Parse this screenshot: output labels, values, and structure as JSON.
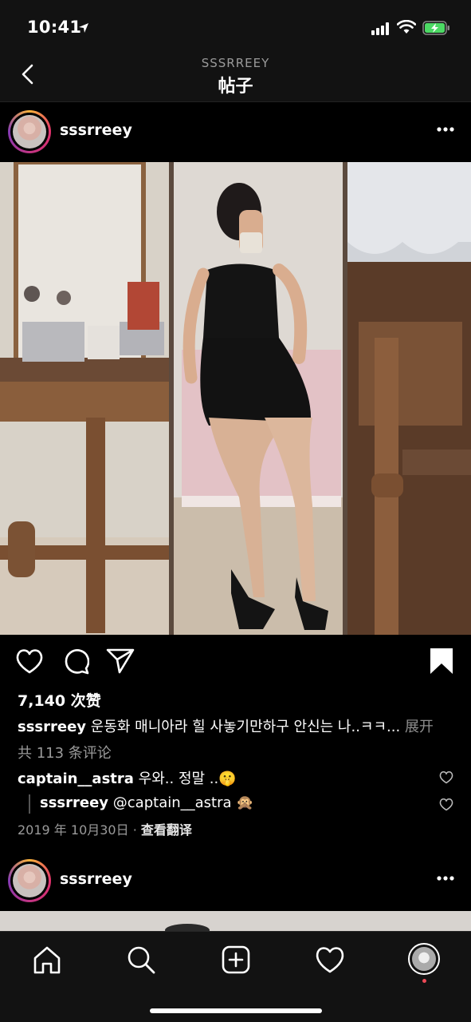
{
  "status_bar": {
    "time": "10:41"
  },
  "nav": {
    "subtitle": "SSSRREEY",
    "title": "帖子"
  },
  "post": {
    "username": "sssrreey",
    "likes": "7,140 次赞",
    "caption_user": "sssrreey",
    "caption_text": "운동화 매니아라 힐 사놓기만하구 안신는 나..ㅋㅋ...",
    "caption_more": "展开",
    "comments_count": "共 113 条评论",
    "comments": [
      {
        "user": "captain__astra",
        "text": "우와.. 정말 ..🤫"
      },
      {
        "user": "sssrreey",
        "text": "@captain__astra 🙊"
      }
    ],
    "date": "2019 年 10月30日 ·",
    "translate": "查看翻译"
  },
  "next_post": {
    "username": "sssrreey"
  },
  "icons": {
    "back": "chevron-left-icon",
    "more": "more-horizontal-icon",
    "like": "heart-icon",
    "comment": "comment-icon",
    "share": "paper-plane-icon",
    "save": "bookmark-icon",
    "tabs": [
      "home-icon",
      "search-icon",
      "add-post-icon",
      "activity-heart-icon",
      "profile-avatar"
    ]
  },
  "colors": {
    "background": "#000000",
    "bar": "#121212",
    "muted": "#9a9a9a",
    "notification": "#ed4956",
    "battery": "#4cd964"
  }
}
